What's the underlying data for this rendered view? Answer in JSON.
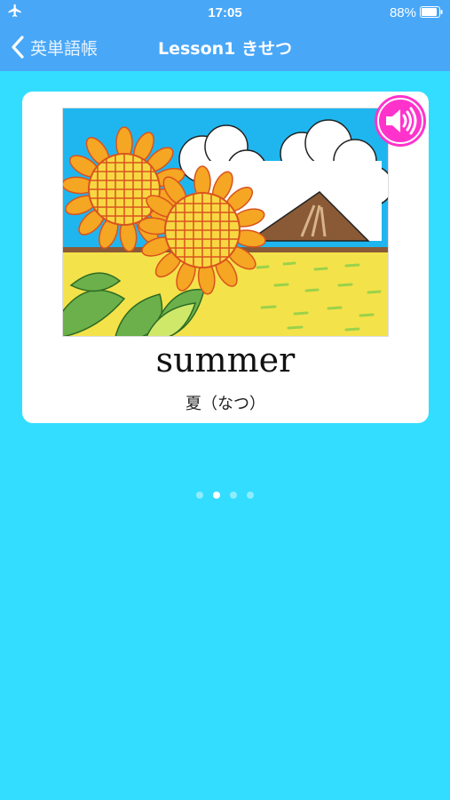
{
  "status_bar": {
    "time": "17:05",
    "battery_percent": "88%",
    "airplane_icon": "airplane-icon",
    "battery_icon": "battery-icon"
  },
  "nav": {
    "back_label": "英単語帳",
    "title": "Lesson1 きせつ"
  },
  "card": {
    "word": "summer",
    "meaning": "夏（なつ）",
    "image_icon": "sunflower-summer-illustration",
    "sound_icon": "speaker-icon"
  },
  "pager": {
    "pages": 4,
    "current": 2
  },
  "colors": {
    "background": "#33ddff",
    "navbar": "#49a7f7",
    "sound_button": "#ff33cc",
    "card": "#ffffff"
  }
}
